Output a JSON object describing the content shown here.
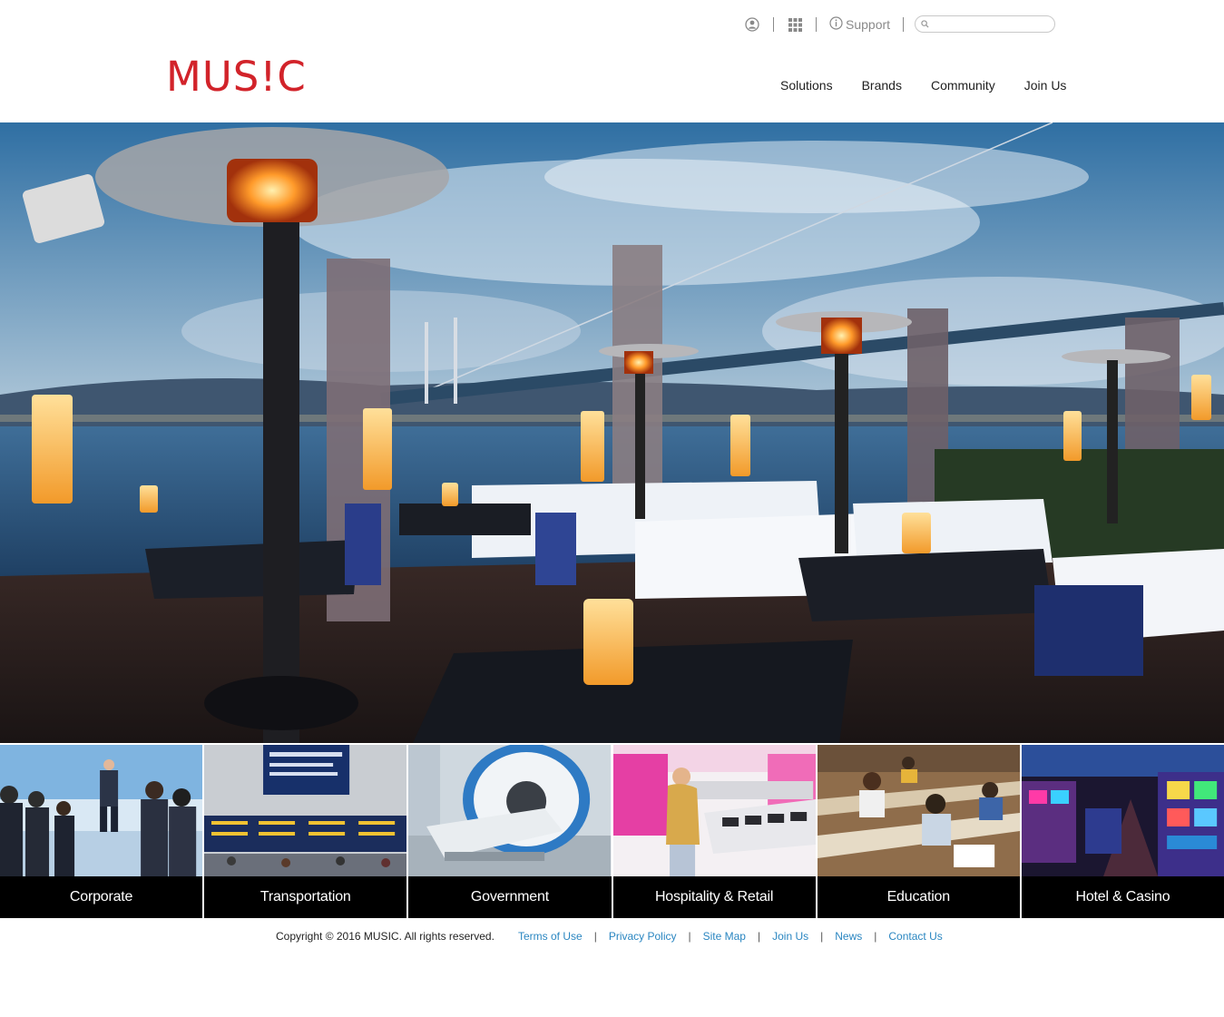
{
  "brand": {
    "logo_text": "MUS!C",
    "logo_color": "#d2232a"
  },
  "utility_bar": {
    "account_icon": "user-circle-icon",
    "apps_icon": "grid-icon",
    "support_icon": "info-circle-icon",
    "support_label": "Support",
    "search_placeholder": "",
    "search_icon": "magnifier-icon"
  },
  "nav": {
    "items": [
      {
        "label": "Solutions"
      },
      {
        "label": "Brands"
      },
      {
        "label": "Community"
      },
      {
        "label": "Join Us"
      }
    ]
  },
  "hero": {
    "scene": "outdoor-terrace-restaurant-photo"
  },
  "categories": [
    {
      "label": "Corporate",
      "icon": "presentation-photo"
    },
    {
      "label": "Transportation",
      "icon": "departure-board-photo"
    },
    {
      "label": "Government",
      "icon": "mri-scanner-photo"
    },
    {
      "label": "Hospitality & Retail",
      "icon": "retail-store-photo"
    },
    {
      "label": "Education",
      "icon": "lecture-hall-photo"
    },
    {
      "label": "Hotel & Casino",
      "icon": "slot-machines-photo"
    }
  ],
  "footer": {
    "copyright": "Copyright © 2016 MUSIC. All rights reserved.",
    "links": [
      {
        "label": "Terms of Use"
      },
      {
        "label": "Privacy Policy"
      },
      {
        "label": "Site Map"
      },
      {
        "label": "Join Us"
      },
      {
        "label": "News"
      },
      {
        "label": "Contact Us"
      }
    ],
    "separator": "|"
  },
  "colors": {
    "link": "#2a86c1",
    "tile_label_bg": "#000000",
    "accent": "#d2232a"
  }
}
